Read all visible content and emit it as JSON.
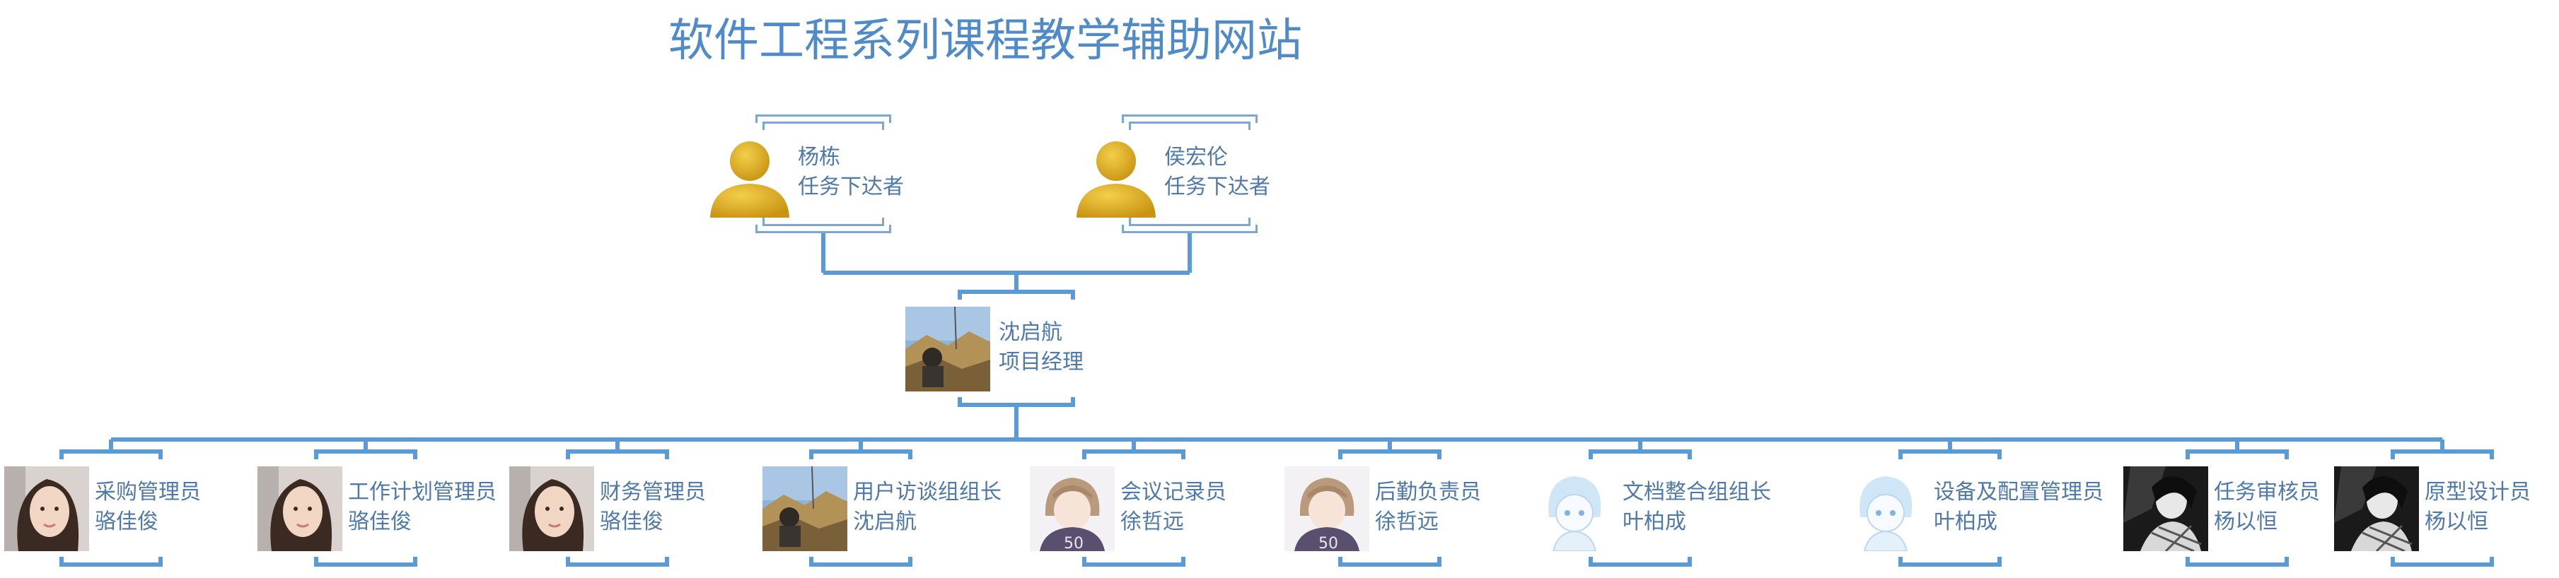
{
  "title": "软件工程系列课程教学辅助网站",
  "colors": {
    "title": "#4f8ac9",
    "label": "#4f79ab",
    "connector": "#5b9bd5"
  },
  "leaders": [
    {
      "name": "杨栋",
      "role": "任务下达者",
      "icon": "person-silhouette-icon"
    },
    {
      "name": "侯宏伦",
      "role": "任务下达者",
      "icon": "person-silhouette-icon"
    }
  ],
  "manager": {
    "name": "沈启航",
    "role": "项目经理",
    "icon": "landscape-photo-icon"
  },
  "members": [
    {
      "role": "采购管理员",
      "name": "骆佳俊",
      "icon": "portrait-photo-icon"
    },
    {
      "role": "工作计划管理员",
      "name": "骆佳俊",
      "icon": "portrait-photo-icon"
    },
    {
      "role": "财务管理员",
      "name": "骆佳俊",
      "icon": "portrait-photo-icon"
    },
    {
      "role": "用户访谈组组长",
      "name": "沈启航",
      "icon": "landscape-photo-icon"
    },
    {
      "role": "会议记录员",
      "name": "徐哲远",
      "icon": "anime-avatar-icon"
    },
    {
      "role": "后勤负责员",
      "name": "徐哲远",
      "icon": "anime-avatar-icon"
    },
    {
      "role": "文档整合组组长",
      "name": "叶柏成",
      "icon": "chibi-avatar-icon"
    },
    {
      "role": "设备及配置管理员",
      "name": "叶柏成",
      "icon": "chibi-avatar-icon"
    },
    {
      "role": "任务审核员",
      "name": "杨以恒",
      "icon": "monochrome-avatar-icon"
    },
    {
      "role": "原型设计员",
      "name": "杨以恒",
      "icon": "monochrome-avatar-icon"
    }
  ]
}
